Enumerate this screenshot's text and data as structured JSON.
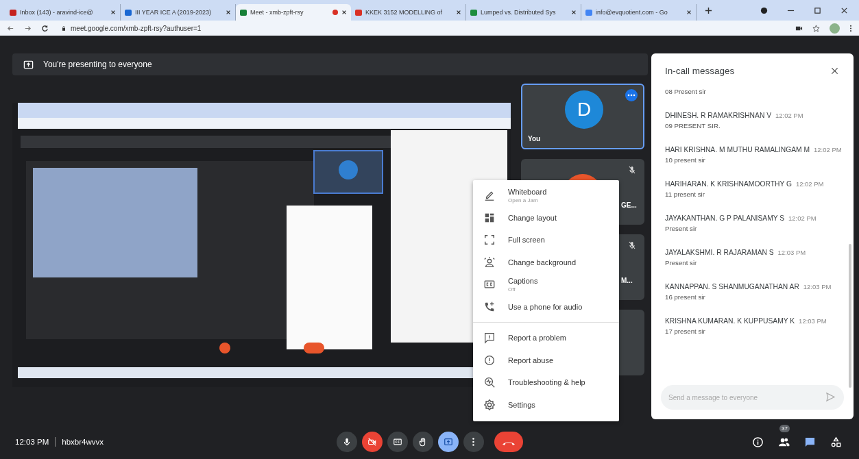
{
  "browser": {
    "tabs": [
      {
        "title": "Inbox (143) - aravind-ice@",
        "selected": false,
        "color": "#c5221f",
        "recording": false
      },
      {
        "title": "III YEAR ICE A (2019-2023)",
        "selected": false,
        "color": "#1967d2",
        "recording": false
      },
      {
        "title": "Meet - xmb-zpft-rsy",
        "selected": true,
        "color": "#188038",
        "recording": true
      },
      {
        "title": "KKEK 3152 MODELLING of",
        "selected": false,
        "color": "#d93025",
        "recording": false
      },
      {
        "title": "Lumped vs. Distributed Sys",
        "selected": false,
        "color": "#1e8e3e",
        "recording": false
      },
      {
        "title": "info@evquotient.com - Go",
        "selected": false,
        "color": "#4285f4",
        "recording": false
      }
    ],
    "url": "meet.google.com/xmb-zpft-rsy?authuser=1"
  },
  "banner": {
    "text": "You're presenting to everyone"
  },
  "tiles": [
    {
      "selected": true,
      "muted": false,
      "avatar": {
        "letter": "D",
        "color": "#1e88d8"
      },
      "name": "You"
    },
    {
      "selected": false,
      "muted": true,
      "avatar": {
        "color": "#e8552b"
      },
      "name": "GE..."
    },
    {
      "selected": false,
      "muted": true,
      "name": "M..."
    },
    {
      "selected": false,
      "muted": false
    }
  ],
  "menu": {
    "sections": [
      {
        "items": [
          {
            "kind": "whiteboard",
            "label": "Whiteboard",
            "sublabel": "Open a Jam"
          },
          {
            "kind": "layout",
            "label": "Change layout"
          },
          {
            "kind": "fullscreen",
            "label": "Full screen"
          },
          {
            "kind": "background",
            "label": "Change background"
          },
          {
            "kind": "captions",
            "label": "Captions",
            "sublabel": "Off"
          },
          {
            "kind": "phone",
            "label": "Use a phone for audio"
          }
        ]
      },
      {
        "items": [
          {
            "kind": "problem",
            "label": "Report a problem"
          },
          {
            "kind": "abuse",
            "label": "Report abuse"
          },
          {
            "kind": "help",
            "label": "Troubleshooting & help"
          },
          {
            "kind": "settings",
            "label": "Settings"
          }
        ]
      }
    ]
  },
  "chat": {
    "title": "In-call messages",
    "messages": [
      {
        "text": "08 Present sir"
      },
      {
        "sender": "DHINESH. R RAMAKRISHNAN V",
        "time": "12:02 PM",
        "text": "09 PRESENT SIR."
      },
      {
        "sender": "HARI KRISHNA. M MUTHU RAMALINGAM M",
        "time": "12:02 PM",
        "text": "10 present sir"
      },
      {
        "sender": "HARIHARAN. K KRISHNAMOORTHY G",
        "time": "12:02 PM",
        "text": "11 present sir"
      },
      {
        "sender": "JAYAKANTHAN. G P PALANISAMY S",
        "time": "12:02 PM",
        "text": "Present sir"
      },
      {
        "sender": "JAYALAKSHMI. R RAJARAMAN S",
        "time": "12:03 PM",
        "text": "Present sir"
      },
      {
        "sender": "KANNAPPAN. S SHANMUGANATHAN AR",
        "time": "12:03 PM",
        "text": "16 present sir"
      },
      {
        "sender": "KRISHNA KUMARAN. K KUPPUSAMY K",
        "time": "12:03 PM",
        "text": "17 present sir"
      }
    ],
    "placeholder": "Send a message to everyone"
  },
  "bottom_bar": {
    "time": "12:03 PM",
    "meeting_code": "hbxbr4wvvx",
    "controls": [
      {
        "kind": "mic",
        "alert": false,
        "selected": false
      },
      {
        "kind": "camera",
        "alert": true,
        "selected": false
      },
      {
        "kind": "captions",
        "alert": false,
        "selected": false
      },
      {
        "kind": "hand",
        "alert": false,
        "selected": false
      },
      {
        "kind": "present",
        "alert": false,
        "selected": true
      },
      {
        "kind": "more",
        "alert": false,
        "selected": false
      },
      {
        "kind": "end",
        "alert": true,
        "selected": false
      }
    ],
    "side_buttons": [
      {
        "kind": "info",
        "selected": false
      },
      {
        "kind": "people",
        "badge": "37",
        "selected": false
      },
      {
        "kind": "chat",
        "selected": true
      },
      {
        "kind": "activities",
        "selected": false
      }
    ]
  }
}
